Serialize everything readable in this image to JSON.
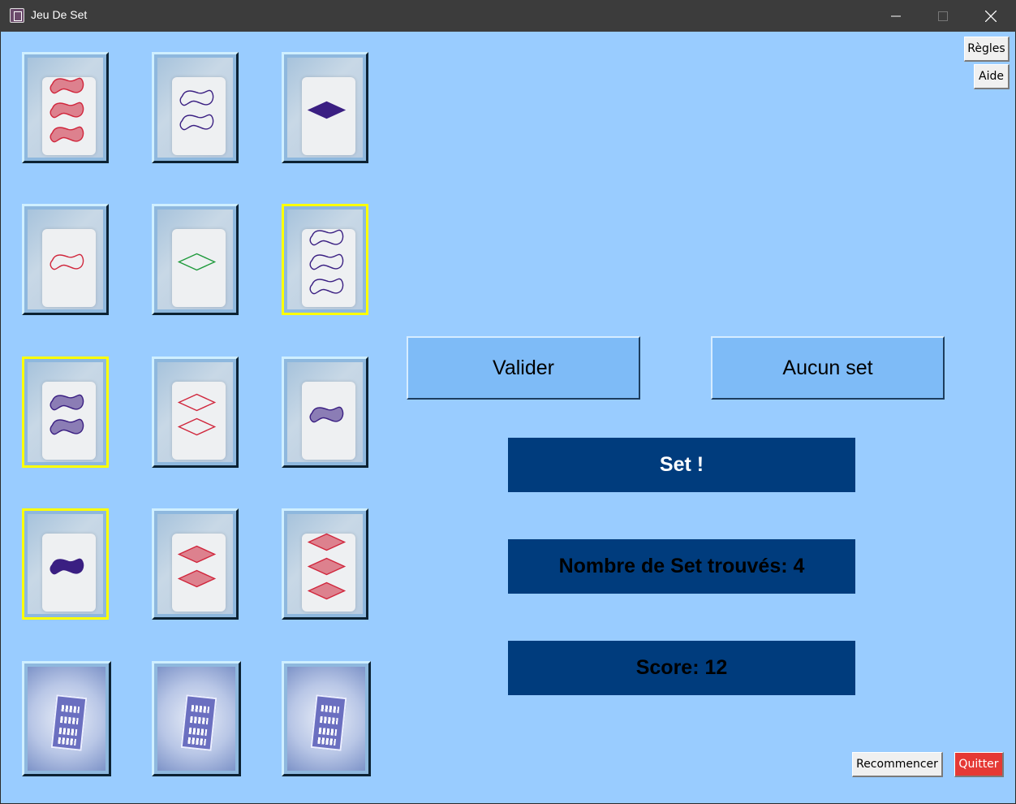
{
  "window": {
    "title": "Jeu De Set",
    "controls": [
      "minimize-icon",
      "maximize-icon",
      "close-icon"
    ]
  },
  "toolbar": {
    "rules_label": "Règles",
    "help_label": "Aide"
  },
  "actions": {
    "validate_label": "Valider",
    "no_set_label": "Aucun set"
  },
  "status": {
    "message": "Set !",
    "sets_found": "Nombre de Set trouvés: 4",
    "score": "Score: 12"
  },
  "footer": {
    "restart_label": "Recommencer",
    "quit_label": "Quitter"
  },
  "colors": {
    "background": "#99ccff",
    "panel": "#003c7d",
    "button": "#7ebbf7",
    "selected": "#ffff00",
    "quit": "#e53935"
  },
  "cards": [
    {
      "count": 3,
      "shape": "squiggle",
      "color": "red",
      "fill": "striped",
      "selected": false
    },
    {
      "count": 2,
      "shape": "squiggle",
      "color": "purple",
      "fill": "empty",
      "selected": false
    },
    {
      "count": 1,
      "shape": "diamond",
      "color": "purple",
      "fill": "solid",
      "selected": false
    },
    {
      "count": 1,
      "shape": "squiggle",
      "color": "red",
      "fill": "empty",
      "selected": false
    },
    {
      "count": 1,
      "shape": "diamond",
      "color": "green",
      "fill": "empty",
      "selected": false
    },
    {
      "count": 3,
      "shape": "squiggle",
      "color": "purple",
      "fill": "empty",
      "selected": true
    },
    {
      "count": 2,
      "shape": "squiggle",
      "color": "purple",
      "fill": "striped",
      "selected": true
    },
    {
      "count": 2,
      "shape": "diamond",
      "color": "red",
      "fill": "empty",
      "selected": false
    },
    {
      "count": 1,
      "shape": "squiggle",
      "color": "purple",
      "fill": "striped",
      "selected": false
    },
    {
      "count": 1,
      "shape": "squiggle",
      "color": "purple",
      "fill": "solid",
      "selected": true
    },
    {
      "count": 2,
      "shape": "diamond",
      "color": "red",
      "fill": "striped",
      "selected": false
    },
    {
      "count": 3,
      "shape": "diamond",
      "color": "red",
      "fill": "striped",
      "selected": false
    },
    {
      "back": true
    },
    {
      "back": true
    },
    {
      "back": true
    }
  ]
}
